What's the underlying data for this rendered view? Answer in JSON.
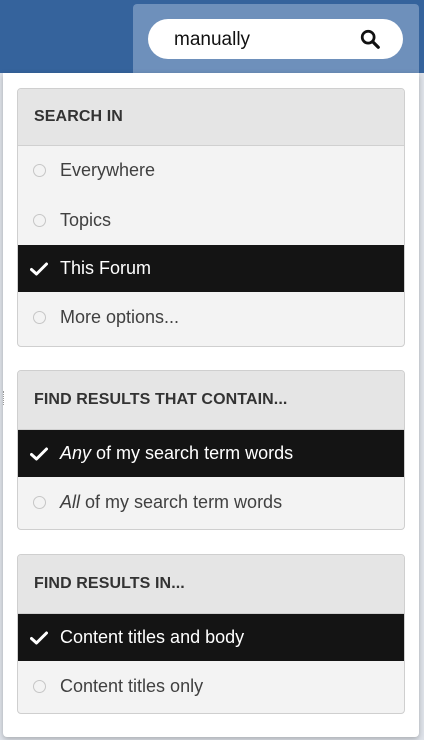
{
  "search": {
    "query": "manually"
  },
  "groups": [
    {
      "title": "SEARCH IN",
      "options": [
        {
          "label": "Everywhere",
          "selected": false
        },
        {
          "label": "Topics",
          "selected": false
        },
        {
          "label": "This Forum",
          "selected": true
        },
        {
          "label": "More options...",
          "selected": false
        }
      ]
    },
    {
      "title": "FIND RESULTS THAT CONTAIN...",
      "options": [
        {
          "emph": "Any",
          "rest": " of my search term words",
          "selected": true
        },
        {
          "emph": "All",
          "rest": " of my search term words",
          "selected": false
        }
      ]
    },
    {
      "title": "FIND RESULTS IN...",
      "options": [
        {
          "label": "Content titles and body",
          "selected": true
        },
        {
          "label": "Content titles only",
          "selected": false
        }
      ]
    }
  ],
  "colors": {
    "header_blue": "#35639c",
    "selected_bg": "#141414"
  },
  "icons": {
    "search": "search-icon",
    "selected": "check-icon",
    "unselected": "radio-icon"
  }
}
